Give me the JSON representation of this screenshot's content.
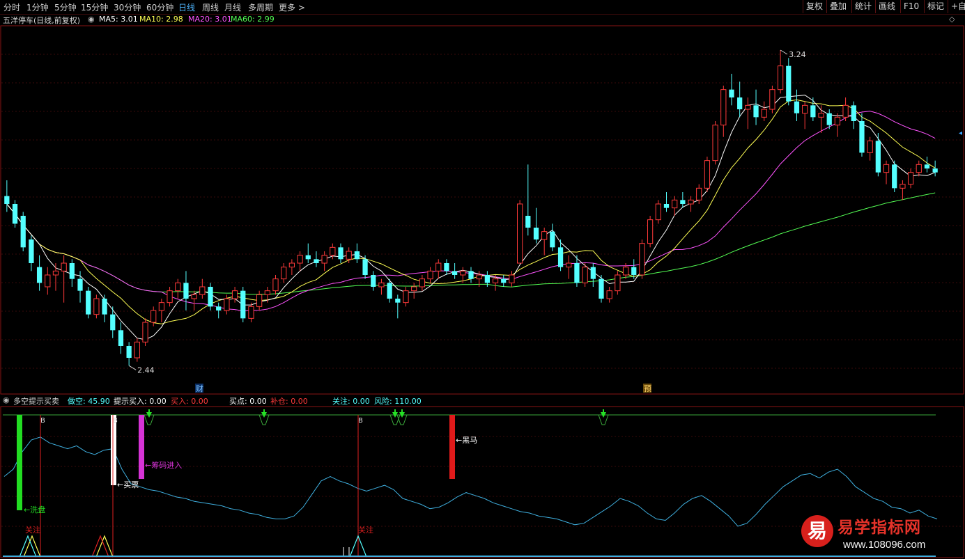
{
  "topbar": {
    "tabs": [
      "分时",
      "1分钟",
      "5分钟",
      "15分钟",
      "30分钟",
      "60分钟",
      "日线",
      "周线",
      "月线",
      "多周期",
      "更多 >"
    ],
    "active_tab": "日线",
    "right_buttons": [
      "复权",
      "叠加",
      "统计",
      "画线",
      "F10",
      "标记",
      "+自"
    ]
  },
  "main": {
    "title": "五洋停车(日线,前复权)",
    "ma5_label": "MA5: 3.01",
    "ma10_label": "MA10: 2.98",
    "ma20_label": "MA20: 3.01",
    "ma60_label": "MA60: 2.99",
    "high_label": "3.24",
    "low_label": "2.44",
    "event_cai": "财",
    "event_yu": "预"
  },
  "indicator": {
    "name": "多空提示买卖",
    "zuokong_label": "做空: 45.90",
    "tishi_label": "提示买入: 0.00",
    "mairu_label": "买入: 0.00",
    "maidian_label": "买点: 0.00",
    "bucang_label": "补仓: 0.00",
    "guanzhu_label": "关注: 0.00",
    "fengxian_label": "风险: 110.00",
    "marks": {
      "xipan": "洗盘",
      "maipiao": "买票",
      "choumajinru": "筹码进入",
      "heima": "黑马",
      "guanzhu1": "关注",
      "guanzhu2": "关注",
      "b": "B"
    }
  },
  "watermark": {
    "logo_char": "易",
    "title": "易学指标网",
    "url": "www.108096.com"
  },
  "colors": {
    "up": "#ff3a3a",
    "down": "#54ffff",
    "ma5": "#ffffff",
    "ma10": "#ffff54",
    "ma20": "#ff54ff",
    "ma60": "#54ff54"
  },
  "chart_data": [
    {
      "type": "candlestick",
      "title": "五洋停车(日线,前复权)",
      "ylim": [
        2.4,
        3.3
      ],
      "price_high": 3.24,
      "price_low": 2.44,
      "candles": [
        [
          2.87,
          2.91,
          2.83,
          2.85
        ],
        [
          2.85,
          2.86,
          2.79,
          2.8
        ],
        [
          2.82,
          2.83,
          2.73,
          2.74
        ],
        [
          2.76,
          2.77,
          2.68,
          2.7
        ],
        [
          2.69,
          2.72,
          2.63,
          2.65
        ],
        [
          2.64,
          2.69,
          2.62,
          2.67
        ],
        [
          2.67,
          2.7,
          2.63,
          2.68
        ],
        [
          2.68,
          2.72,
          2.6,
          2.7
        ],
        [
          2.7,
          2.71,
          2.64,
          2.66
        ],
        [
          2.66,
          2.68,
          2.6,
          2.63
        ],
        [
          2.63,
          2.64,
          2.56,
          2.57
        ],
        [
          2.57,
          2.62,
          2.56,
          2.61
        ],
        [
          2.61,
          2.62,
          2.55,
          2.57
        ],
        [
          2.57,
          2.59,
          2.51,
          2.53
        ],
        [
          2.53,
          2.55,
          2.47,
          2.49
        ],
        [
          2.49,
          2.5,
          2.44,
          2.46
        ],
        [
          2.46,
          2.51,
          2.45,
          2.5
        ],
        [
          2.5,
          2.56,
          2.49,
          2.55
        ],
        [
          2.55,
          2.59,
          2.54,
          2.58
        ],
        [
          2.58,
          2.61,
          2.55,
          2.6
        ],
        [
          2.6,
          2.64,
          2.59,
          2.63
        ],
        [
          2.63,
          2.66,
          2.61,
          2.65
        ],
        [
          2.65,
          2.68,
          2.58,
          2.61
        ],
        [
          2.61,
          2.63,
          2.58,
          2.62
        ],
        [
          2.62,
          2.66,
          2.61,
          2.64
        ],
        [
          2.64,
          2.65,
          2.58,
          2.59
        ],
        [
          2.59,
          2.6,
          2.56,
          2.58
        ],
        [
          2.58,
          2.62,
          2.57,
          2.61
        ],
        [
          2.61,
          2.64,
          2.6,
          2.63
        ],
        [
          2.63,
          2.64,
          2.55,
          2.56
        ],
        [
          2.56,
          2.6,
          2.55,
          2.59
        ],
        [
          2.59,
          2.63,
          2.58,
          2.62
        ],
        [
          2.62,
          2.64,
          2.6,
          2.63
        ],
        [
          2.63,
          2.67,
          2.62,
          2.66
        ],
        [
          2.66,
          2.7,
          2.65,
          2.69
        ],
        [
          2.69,
          2.71,
          2.67,
          2.7
        ],
        [
          2.7,
          2.73,
          2.68,
          2.72
        ],
        [
          2.72,
          2.75,
          2.7,
          2.71
        ],
        [
          2.71,
          2.73,
          2.69,
          2.7
        ],
        [
          2.7,
          2.73,
          2.68,
          2.72
        ],
        [
          2.72,
          2.75,
          2.71,
          2.74
        ],
        [
          2.74,
          2.75,
          2.7,
          2.71
        ],
        [
          2.71,
          2.74,
          2.7,
          2.73
        ],
        [
          2.73,
          2.75,
          2.7,
          2.71
        ],
        [
          2.71,
          2.72,
          2.66,
          2.67
        ],
        [
          2.67,
          2.68,
          2.63,
          2.64
        ],
        [
          2.64,
          2.66,
          2.62,
          2.65
        ],
        [
          2.65,
          2.66,
          2.6,
          2.61
        ],
        [
          2.61,
          2.62,
          2.56,
          2.6
        ],
        [
          2.6,
          2.64,
          2.59,
          2.63
        ],
        [
          2.63,
          2.65,
          2.61,
          2.64
        ],
        [
          2.64,
          2.67,
          2.63,
          2.66
        ],
        [
          2.66,
          2.69,
          2.65,
          2.68
        ],
        [
          2.68,
          2.71,
          2.66,
          2.7
        ],
        [
          2.7,
          2.71,
          2.67,
          2.68
        ],
        [
          2.68,
          2.7,
          2.66,
          2.67
        ],
        [
          2.67,
          2.69,
          2.65,
          2.68
        ],
        [
          2.68,
          2.69,
          2.65,
          2.66
        ],
        [
          2.66,
          2.68,
          2.64,
          2.67
        ],
        [
          2.67,
          2.68,
          2.64,
          2.65
        ],
        [
          2.65,
          2.67,
          2.63,
          2.66
        ],
        [
          2.66,
          2.67,
          2.64,
          2.65
        ],
        [
          2.65,
          2.68,
          2.64,
          2.67
        ],
        [
          2.7,
          2.86,
          2.7,
          2.85
        ],
        [
          2.82,
          2.95,
          2.77,
          2.79
        ],
        [
          2.79,
          2.84,
          2.75,
          2.76
        ],
        [
          2.76,
          2.79,
          2.72,
          2.78
        ],
        [
          2.78,
          2.8,
          2.73,
          2.74
        ],
        [
          2.74,
          2.76,
          2.68,
          2.69
        ],
        [
          2.69,
          2.72,
          2.66,
          2.7
        ],
        [
          2.7,
          2.72,
          2.64,
          2.65
        ],
        [
          2.65,
          2.7,
          2.64,
          2.69
        ],
        [
          2.69,
          2.7,
          2.64,
          2.66
        ],
        [
          2.66,
          2.67,
          2.6,
          2.61
        ],
        [
          2.61,
          2.64,
          2.6,
          2.63
        ],
        [
          2.63,
          2.68,
          2.62,
          2.67
        ],
        [
          2.67,
          2.7,
          2.66,
          2.69
        ],
        [
          2.69,
          2.71,
          2.66,
          2.67
        ],
        [
          2.67,
          2.76,
          2.66,
          2.75
        ],
        [
          2.75,
          2.82,
          2.74,
          2.81
        ],
        [
          2.81,
          2.86,
          2.8,
          2.85
        ],
        [
          2.85,
          2.88,
          2.83,
          2.84
        ],
        [
          2.84,
          2.87,
          2.82,
          2.86
        ],
        [
          2.86,
          2.88,
          2.84,
          2.85
        ],
        [
          2.85,
          2.87,
          2.83,
          2.86
        ],
        [
          2.86,
          2.9,
          2.85,
          2.89
        ],
        [
          2.89,
          2.97,
          2.88,
          2.96
        ],
        [
          2.96,
          3.06,
          2.95,
          3.05
        ],
        [
          3.05,
          3.15,
          3.02,
          3.14
        ],
        [
          3.14,
          3.18,
          3.1,
          3.12
        ],
        [
          3.12,
          3.16,
          3.07,
          3.09
        ],
        [
          3.09,
          3.12,
          3.04,
          3.1
        ],
        [
          3.1,
          3.14,
          3.05,
          3.07
        ],
        [
          3.07,
          3.11,
          3.06,
          3.09
        ],
        [
          3.09,
          3.15,
          3.08,
          3.14
        ],
        [
          3.14,
          3.24,
          3.13,
          3.2
        ],
        [
          3.2,
          3.22,
          3.1,
          3.11
        ],
        [
          3.11,
          3.14,
          3.06,
          3.08
        ],
        [
          3.08,
          3.11,
          3.04,
          3.1
        ],
        [
          3.1,
          3.12,
          3.06,
          3.07
        ],
        [
          3.07,
          3.1,
          3.03,
          3.08
        ],
        [
          3.08,
          3.09,
          3.04,
          3.05
        ],
        [
          3.05,
          3.08,
          3.02,
          3.07
        ],
        [
          3.07,
          3.12,
          3.06,
          3.1
        ],
        [
          3.1,
          3.11,
          3.04,
          3.06
        ],
        [
          3.06,
          3.08,
          2.97,
          2.98
        ],
        [
          2.98,
          3.02,
          2.96,
          3.01
        ],
        [
          3.01,
          3.03,
          2.92,
          2.93
        ],
        [
          2.93,
          2.96,
          2.9,
          2.95
        ],
        [
          2.95,
          2.96,
          2.88,
          2.89
        ],
        [
          2.89,
          2.91,
          2.86,
          2.9
        ],
        [
          2.9,
          2.94,
          2.89,
          2.93
        ],
        [
          2.93,
          2.96,
          2.92,
          2.95
        ],
        [
          2.95,
          2.97,
          2.93,
          2.94
        ],
        [
          2.94,
          2.96,
          2.92,
          2.93
        ]
      ],
      "ma_series": [
        {
          "name": "MA5",
          "last": 3.01
        },
        {
          "name": "MA10",
          "last": 2.98
        },
        {
          "name": "MA20",
          "last": 3.01
        },
        {
          "name": "MA60",
          "last": 2.99
        }
      ]
    },
    {
      "type": "line",
      "title": "多空提示买卖",
      "series": [
        {
          "name": "做空",
          "values": [
            55,
            60,
            72,
            80,
            82,
            78,
            76,
            74,
            76,
            72,
            70,
            73,
            74,
            60,
            50,
            48,
            46,
            45,
            43,
            41,
            40,
            38,
            37,
            36,
            35,
            33,
            32,
            30,
            29,
            27,
            26,
            26,
            28,
            34,
            43,
            52,
            55,
            52,
            50,
            47,
            45,
            47,
            49,
            46,
            40,
            38,
            36,
            33,
            34,
            37,
            41,
            44,
            42,
            40,
            37,
            35,
            33,
            31,
            30,
            28,
            27,
            26,
            24,
            22,
            23,
            27,
            31,
            35,
            40,
            38,
            35,
            30,
            26,
            25,
            30,
            36,
            40,
            42,
            38,
            33,
            28,
            21,
            23,
            29,
            36,
            42,
            48,
            52,
            56,
            57,
            54,
            58,
            60,
            55,
            48,
            44,
            40,
            38,
            34,
            33,
            30,
            32,
            28,
            26
          ]
        }
      ]
    }
  ]
}
